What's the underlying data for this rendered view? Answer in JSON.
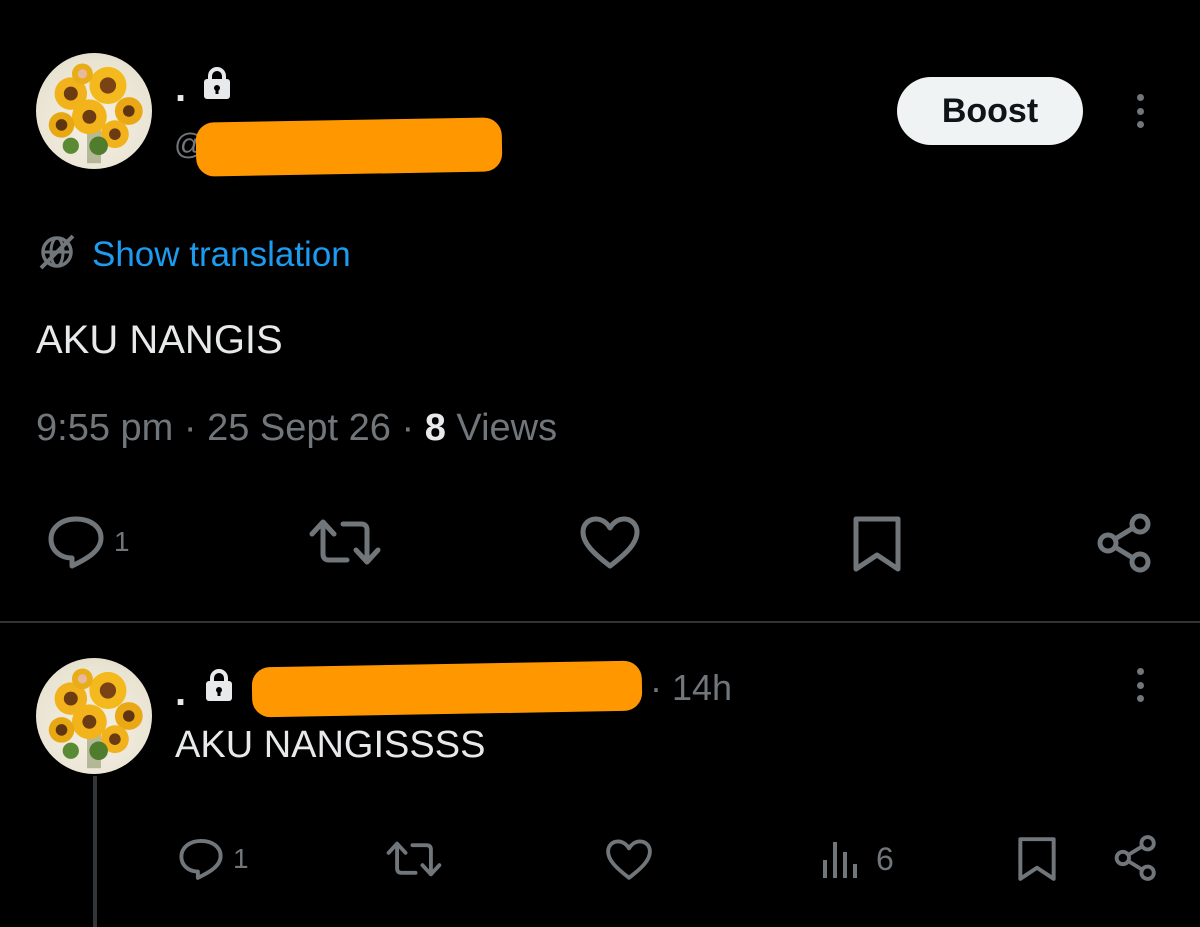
{
  "post": {
    "display_name": ".",
    "handle_prefix": "@",
    "boost_label": "Boost",
    "translate_label": "Show translation",
    "text": "AKU NANGIS",
    "time": "9:55 pm",
    "date": "25 Sept 26",
    "views_count": "8",
    "views_label": "Views",
    "reply_count": "1",
    "icons": {
      "lock": "lock-icon",
      "more": "more-vertical-icon",
      "translate": "globe-slash-icon",
      "reply": "reply-icon",
      "repost": "repost-icon",
      "like": "heart-icon",
      "bookmark": "bookmark-icon",
      "share": "share-icon"
    }
  },
  "reply": {
    "display_name": ".",
    "time_ago": "· 14h",
    "text": "AKU NANGISSSS",
    "reply_count": "1",
    "views_count": "6",
    "icons": {
      "lock": "lock-icon",
      "more": "more-vertical-icon",
      "reply": "reply-icon",
      "repost": "repost-icon",
      "like": "heart-icon",
      "views": "analytics-icon",
      "bookmark": "bookmark-icon",
      "share": "share-icon"
    }
  },
  "colors": {
    "background": "#000000",
    "text": "#e7e9ea",
    "muted": "#71767b",
    "link": "#1d9bf0",
    "redaction": "#ff9800"
  }
}
